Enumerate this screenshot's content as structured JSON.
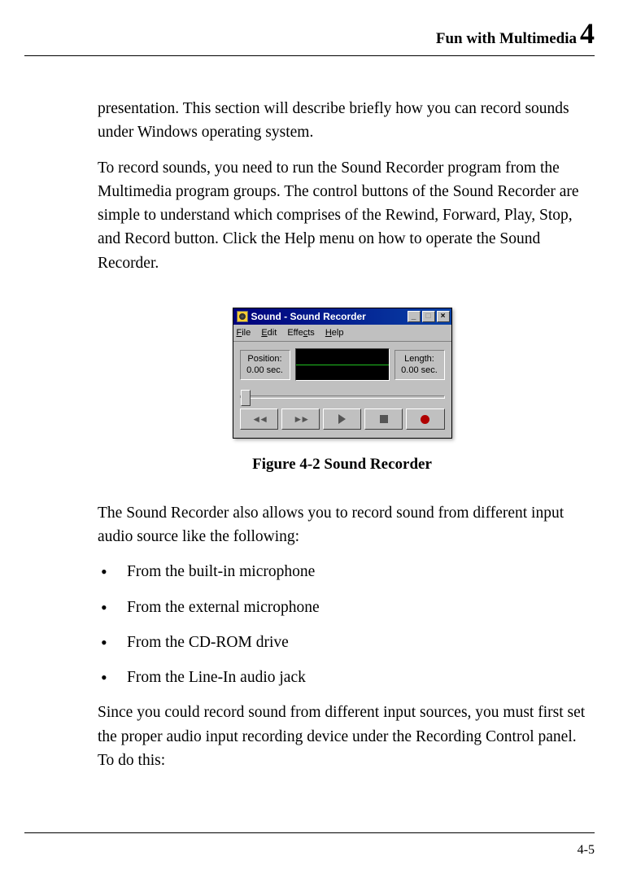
{
  "header": {
    "title": "Fun with Multimedia",
    "chapter_num": "4"
  },
  "body": {
    "para1": "presentation. This section will describe briefly how you can record sounds under Windows operating system.",
    "para2": "To record sounds, you need to run the Sound Recorder program from the Multimedia program groups. The control buttons of the Sound Recorder are simple to understand which comprises of the Rewind, Forward, Play, Stop, and Record button. Click the Help menu on how to operate the Sound Recorder.",
    "figure_caption": "Figure 4-2    Sound Recorder",
    "para3": "The Sound Recorder also allows you to record sound from different input audio source like the following:",
    "bullets": [
      "From the built-in microphone",
      "From the external microphone",
      "From the CD-ROM drive",
      "From the Line-In audio jack"
    ],
    "para4": "Since you could record sound from different input sources, you must first set the proper audio input recording device under the Recording Control panel. To do this:"
  },
  "sound_recorder": {
    "title": "Sound - Sound Recorder",
    "menu_file": "File",
    "menu_edit": "Edit",
    "menu_effects": "Effects",
    "menu_help": "Help",
    "position_label": "Position:",
    "position_value": "0.00 sec.",
    "length_label": "Length:",
    "length_value": "0.00 sec."
  },
  "footer": {
    "page_num": "4-5"
  }
}
